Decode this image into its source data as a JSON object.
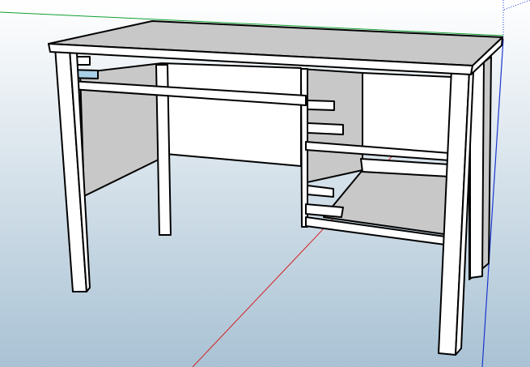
{
  "viewport": {
    "sky_top_color": "#ffffff",
    "sky_bottom_color": "#a9c2d4",
    "edge_color": "#000000",
    "face_light": "#ffffff",
    "face_shadow": "#c8c8c8",
    "selection_color": "#a8d0e6"
  },
  "axes": {
    "red_axis_color": "#d42020",
    "green_axis_color": "#10a030",
    "blue_axis_color": "#1a35d0"
  },
  "model": {
    "object": "desk",
    "has_selected_face": true
  }
}
